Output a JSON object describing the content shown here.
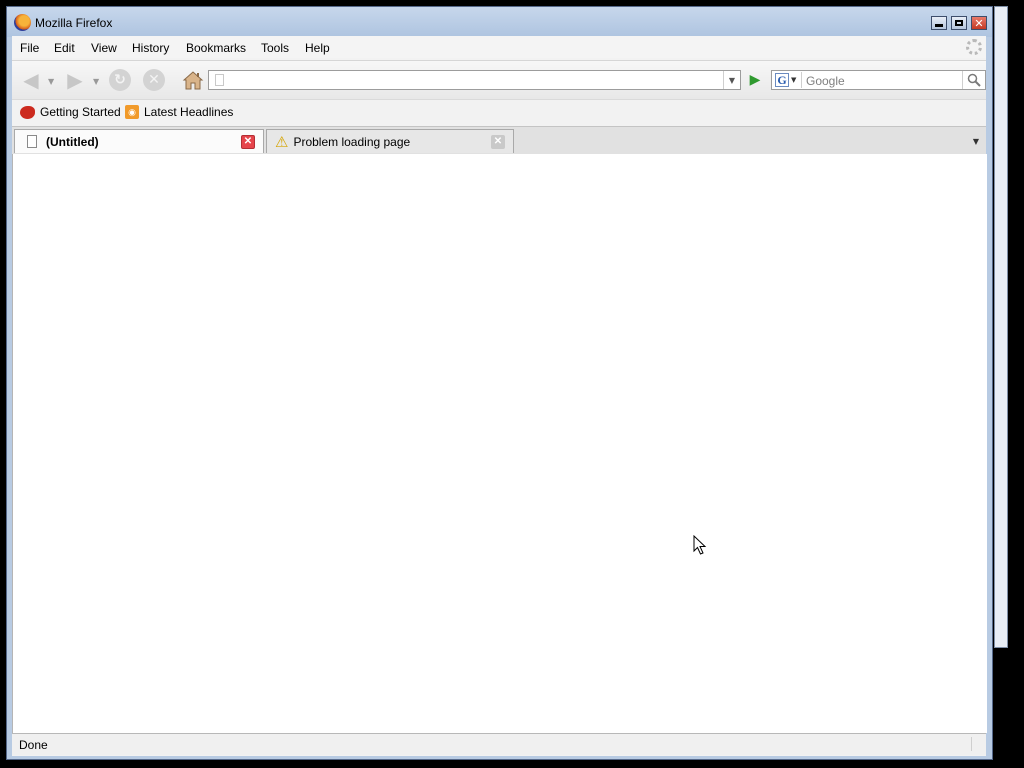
{
  "window": {
    "title": "Mozilla Firefox",
    "minimize_icon": "minimize-icon",
    "maximize_icon": "maximize-icon",
    "close_label": "✕"
  },
  "menubar": {
    "items": [
      "File",
      "Edit",
      "View",
      "History",
      "Bookmarks",
      "Tools",
      "Help"
    ]
  },
  "navbar": {
    "back_icon": "back-arrow-icon",
    "forward_icon": "forward-arrow-icon",
    "reload_icon": "reload-icon",
    "stop_icon": "stop-icon",
    "home_icon": "home-icon",
    "url_value": "",
    "go_icon": "go-arrow-icon",
    "search_engine_letter": "G",
    "search_placeholder": "Google",
    "search_icon": "magnifier-icon"
  },
  "bookmarks": {
    "items": [
      {
        "label": "Getting Started",
        "icon": "firefox-bookmark-icon"
      },
      {
        "label": "Latest Headlines",
        "icon": "rss-feed-icon"
      }
    ]
  },
  "tabs": [
    {
      "label": "(Untitled)",
      "active": true,
      "icon": "page-icon"
    },
    {
      "label": "Problem loading page",
      "active": false,
      "icon": "warning-icon"
    }
  ],
  "status": {
    "text": "Done"
  },
  "colors": {
    "titlebar": "#b8cbe3",
    "tab_close_active": "#e6444b",
    "go_arrow": "#2f9a2f"
  }
}
